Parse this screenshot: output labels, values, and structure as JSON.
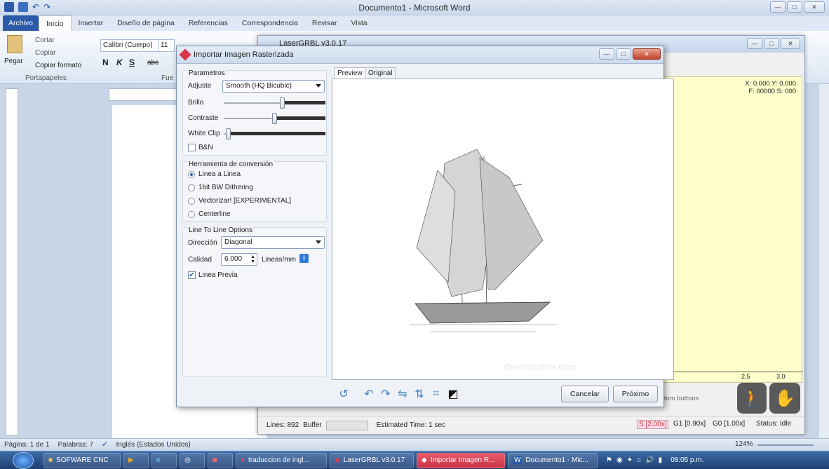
{
  "word": {
    "title": "Documento1 - Microsoft Word",
    "tabs": [
      "Archivo",
      "Inicio",
      "Insertar",
      "Diseño de página",
      "Referencias",
      "Correspondencia",
      "Revisar",
      "Vista"
    ],
    "clipboard": {
      "paste": "Pegar",
      "cut": "Cortar",
      "copy": "Copiar",
      "format": "Copiar formato",
      "group": "Portapapeles"
    },
    "font": {
      "name": "Calibri (Cuerpo)",
      "size": "11",
      "bold": "N",
      "italic": "K",
      "underline": "S",
      "strike": "abc",
      "group": "Fue"
    },
    "status": {
      "page": "Página: 1 de 1",
      "words": "Palabras: 7",
      "lang": "Inglés (Estados Unidos)",
      "zoom": "124%"
    }
  },
  "laser": {
    "title": "LaserGRBL v3.0.17",
    "coords_line1": "X: 0.000 Y: 0.000",
    "coords_line2": "F: 00000 S: 000",
    "ruler": [
      ".0",
      "2.5",
      "3.0"
    ],
    "custom_buttons": "stom buttons",
    "lines": "Lines: 892",
    "buffer": "Buffer",
    "estimated": "Estimated Time: 1 sec",
    "s": "S [2.00x]",
    "g1": "G1 [0.90x]",
    "g0": "G0 [1.00x]",
    "status": "Status: Idle"
  },
  "dialog": {
    "title": "Importar Imagen Rasterizada",
    "params_title": "Parametros",
    "adjust_label": "Adjuste",
    "adjust_value": "Smooth (HQ Bicubic)",
    "brightness_label": "Brillo",
    "brightness_value": 0.58,
    "contrast_label": "Contraste",
    "contrast_value": 0.5,
    "whiteclip_label": "White Clip",
    "whiteclip_value": 0.02,
    "bn_label": "B&N",
    "tool_title": "Herramienta de conversión",
    "tools": [
      "Linea a Linea",
      "1bit BW Dithering",
      "Vectorizar! [EXPERIMENTAL]",
      "Centerline"
    ],
    "l2l_title": "Line To Line Options",
    "direction_label": "Dirección",
    "direction_value": "Diagonal",
    "quality_label": "Calidad",
    "quality_value": "6.000",
    "quality_unit": "Lineas/mm",
    "preview_line_label": "Linea Previa",
    "tab_preview": "Preview",
    "tab_original": "Original",
    "watermark": "dreamstime.com",
    "cancel": "Cancelar",
    "next": "Próximo"
  },
  "taskbar": {
    "items": [
      "SOFWARE CNC",
      "traduccion de ingl...",
      "LaserGRBL v3.0.17",
      "Importar Imagen R...",
      "Documento1 - Mic..."
    ],
    "clock": "08:05 p.m."
  },
  "colors": {
    "accent": "#2a5aa8",
    "laser_canvas": "#ffffcc",
    "taskbar_highlight": "#c93447"
  }
}
